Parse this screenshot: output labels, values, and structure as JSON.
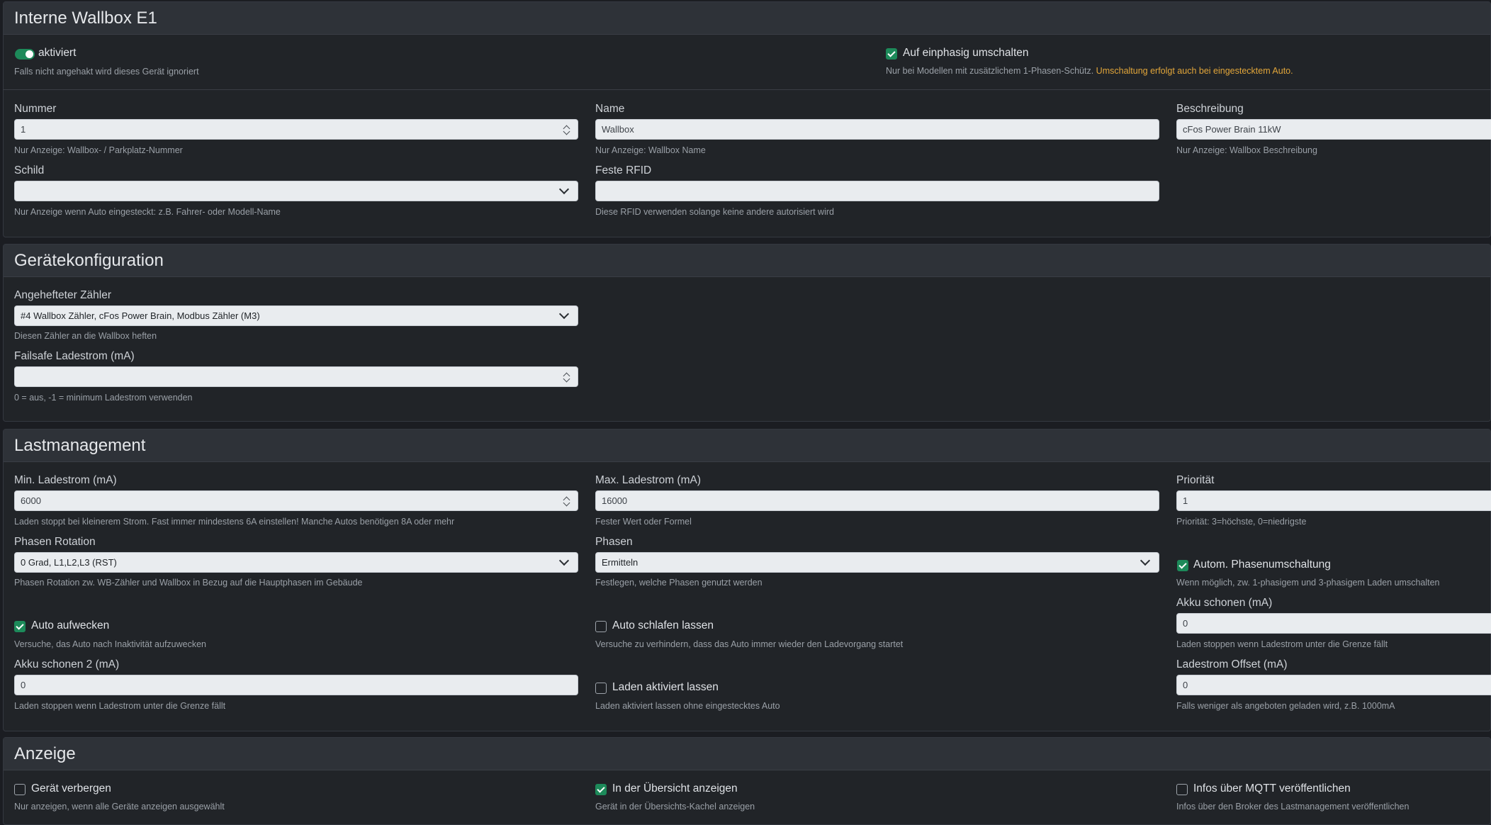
{
  "colors": {
    "accent": "#1d8a5a",
    "warning": "#e2a63a",
    "background": "#1b1d22",
    "card": "#212428"
  },
  "wallbox": {
    "title": "Interne Wallbox E1",
    "aktiviert": {
      "label": "aktiviert",
      "help": "Falls nicht angehakt wird dieses Gerät ignoriert",
      "checked": true
    },
    "einphasig": {
      "label": "Auf einphasig umschalten",
      "help": "Nur bei Modellen mit zusätzlichem 1-Phasen-Schütz.",
      "warning": "Umschaltung erfolgt auch bei eingestecktem Auto.",
      "checked": true
    },
    "nummer": {
      "label": "Nummer",
      "value": "1",
      "help": "Nur Anzeige: Wallbox- / Parkplatz-Nummer"
    },
    "name": {
      "label": "Name",
      "value": "Wallbox",
      "help": "Nur Anzeige: Wallbox Name"
    },
    "beschreibung": {
      "label": "Beschreibung",
      "value": "cFos Power Brain 11kW",
      "help": "Nur Anzeige: Wallbox Beschreibung"
    },
    "schild": {
      "label": "Schild",
      "value": "",
      "help": "Nur Anzeige wenn Auto eingesteckt: z.B. Fahrer- oder Modell-Name"
    },
    "rfid": {
      "label": "Feste RFID",
      "value": "",
      "help": "Diese RFID verwenden solange keine andere autorisiert wird"
    }
  },
  "geraet": {
    "title": "Gerätekonfiguration",
    "zaehler": {
      "label": "Angehefteter Zähler",
      "value": "#4 Wallbox Zähler, cFos Power Brain, Modbus Zähler (M3)",
      "help": "Diesen Zähler an die Wallbox heften"
    },
    "failsafe": {
      "label": "Failsafe Ladestrom (mA)",
      "value": "",
      "help": "0 = aus, -1 = minimum Ladestrom verwenden"
    }
  },
  "last": {
    "title": "Lastmanagement",
    "min": {
      "label": "Min. Ladestrom (mA)",
      "value": "6000",
      "help": "Laden stoppt bei kleinerem Strom. Fast immer mindestens 6A einstellen! Manche Autos benötigen 8A oder mehr"
    },
    "max": {
      "label": "Max. Ladestrom (mA)",
      "value": "16000",
      "help": "Fester Wert oder Formel"
    },
    "prio": {
      "label": "Priorität",
      "value": "1",
      "help": "Priorität: 3=höchste, 0=niedrigste"
    },
    "rotation": {
      "label": "Phasen Rotation",
      "value": "0 Grad, L1,L2,L3 (RST)",
      "help": "Phasen Rotation zw. WB-Zähler und Wallbox in Bezug auf die Hauptphasen im Gebäude"
    },
    "phasen": {
      "label": "Phasen",
      "value": "Ermitteln",
      "help": "Festlegen, welche Phasen genutzt werden"
    },
    "autom": {
      "label": "Autom. Phasenumschaltung",
      "help": "Wenn möglich, zw. 1-phasigem und 3-phasigem Laden umschalten",
      "checked": true
    },
    "aufwecken": {
      "label": "Auto aufwecken",
      "help": "Versuche, das Auto nach Inaktivität aufzuwecken",
      "checked": true
    },
    "schlafen": {
      "label": "Auto schlafen lassen",
      "help": "Versuche zu verhindern, dass das Auto immer wieder den Ladevorgang startet",
      "checked": false
    },
    "akku": {
      "label": "Akku schonen (mA)",
      "value": "0",
      "help": "Laden stoppen wenn Ladestrom unter die Grenze fällt"
    },
    "akku2": {
      "label": "Akku schonen 2 (mA)",
      "value": "0",
      "help": "Laden stoppen wenn Ladestrom unter die Grenze fällt"
    },
    "aktiv": {
      "label": "Laden aktiviert lassen",
      "help": "Laden aktiviert lassen ohne eingestecktes Auto",
      "checked": false
    },
    "offset": {
      "label": "Ladestrom Offset (mA)",
      "value": "0",
      "help": "Falls weniger als angeboten geladen wird, z.B. 1000mA"
    }
  },
  "anzeige": {
    "title": "Anzeige",
    "verbergen": {
      "label": "Gerät verbergen",
      "help": "Nur anzeigen, wenn alle Geräte anzeigen ausgewählt",
      "checked": false
    },
    "uebersicht": {
      "label": "In der Übersicht anzeigen",
      "help": "Gerät in der Übersichts-Kachel anzeigen",
      "checked": true
    },
    "mqtt": {
      "label": "Infos über MQTT veröffentlichen",
      "help": "Infos über den Broker des Lastmanagement veröffentlichen",
      "checked": false
    }
  }
}
